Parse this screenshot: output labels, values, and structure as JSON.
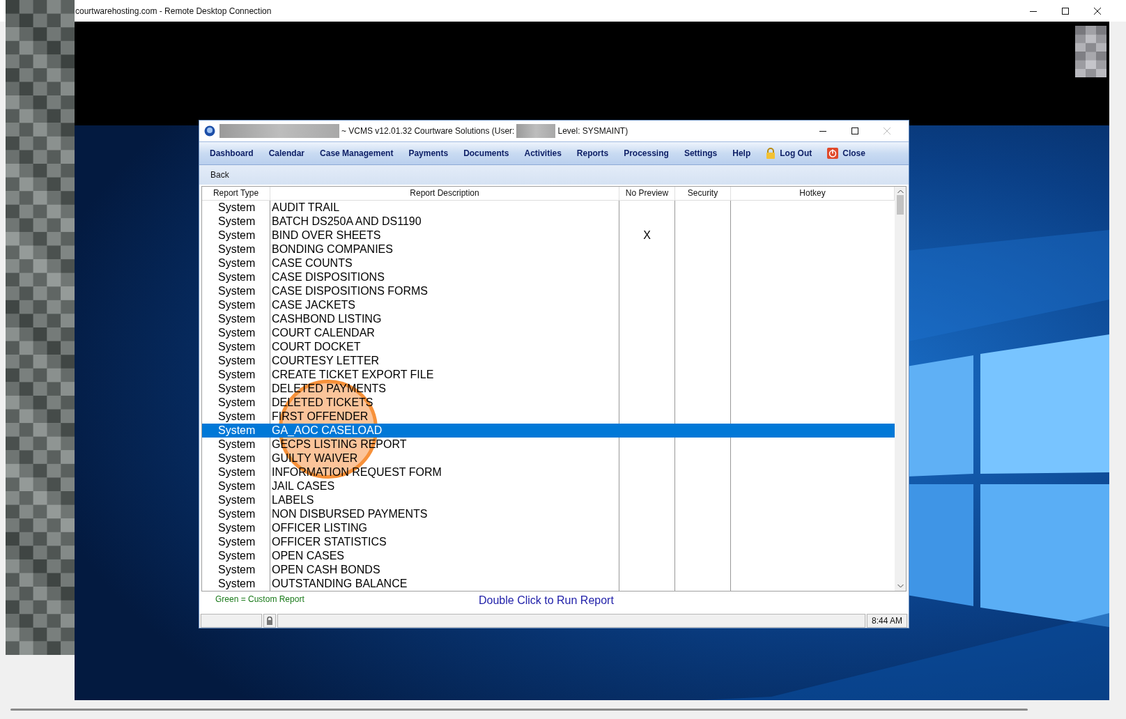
{
  "remote_window": {
    "title": "courtwarehosting.com - Remote Desktop Connection"
  },
  "app_window": {
    "title_prefix": "~ VCMS v12.01.32 Courtware Solutions (User:",
    "title_suffix": "Level: SYSMAINT)"
  },
  "menu": [
    {
      "label": "Dashboard",
      "kind": "text"
    },
    {
      "label": "Calendar",
      "kind": "text"
    },
    {
      "label": "Case Management",
      "kind": "text"
    },
    {
      "label": "Payments",
      "kind": "text"
    },
    {
      "label": "Documents",
      "kind": "text"
    },
    {
      "label": "Activities",
      "kind": "text"
    },
    {
      "label": "Reports",
      "kind": "text"
    },
    {
      "label": "Processing",
      "kind": "text"
    },
    {
      "label": "Settings",
      "kind": "text"
    },
    {
      "label": "Help",
      "kind": "text"
    },
    {
      "label": "Log Out",
      "kind": "lock"
    },
    {
      "label": "Close",
      "kind": "power"
    }
  ],
  "back_button": "Back",
  "table": {
    "columns": [
      "Report Type",
      "Report Description",
      "No Preview",
      "Security",
      "Hotkey"
    ],
    "rows": [
      {
        "type": "System",
        "description": "AUDIT TRAIL",
        "no_preview": "",
        "selected": false
      },
      {
        "type": "System",
        "description": "BATCH DS250A AND DS1190",
        "no_preview": "",
        "selected": false
      },
      {
        "type": "System",
        "description": "BIND OVER SHEETS",
        "no_preview": "X",
        "selected": false
      },
      {
        "type": "System",
        "description": "BONDING COMPANIES",
        "no_preview": "",
        "selected": false
      },
      {
        "type": "System",
        "description": "CASE COUNTS",
        "no_preview": "",
        "selected": false
      },
      {
        "type": "System",
        "description": "CASE DISPOSITIONS",
        "no_preview": "",
        "selected": false
      },
      {
        "type": "System",
        "description": "CASE DISPOSITIONS FORMS",
        "no_preview": "",
        "selected": false
      },
      {
        "type": "System",
        "description": "CASE JACKETS",
        "no_preview": "",
        "selected": false
      },
      {
        "type": "System",
        "description": "CASHBOND LISTING",
        "no_preview": "",
        "selected": false
      },
      {
        "type": "System",
        "description": "COURT CALENDAR",
        "no_preview": "",
        "selected": false
      },
      {
        "type": "System",
        "description": "COURT DOCKET",
        "no_preview": "",
        "selected": false
      },
      {
        "type": "System",
        "description": "COURTESY LETTER",
        "no_preview": "",
        "selected": false
      },
      {
        "type": "System",
        "description": "CREATE TICKET EXPORT FILE",
        "no_preview": "",
        "selected": false
      },
      {
        "type": "System",
        "description": "DELETED PAYMENTS",
        "no_preview": "",
        "selected": false
      },
      {
        "type": "System",
        "description": "DELETED TICKETS",
        "no_preview": "",
        "selected": false
      },
      {
        "type": "System",
        "description": "FIRST OFFENDER",
        "no_preview": "",
        "selected": false
      },
      {
        "type": "System",
        "description": "GA_AOC CASELOAD",
        "no_preview": "",
        "selected": true
      },
      {
        "type": "System",
        "description": "GECPS LISTING REPORT",
        "no_preview": "",
        "selected": false
      },
      {
        "type": "System",
        "description": "GUILTY WAIVER",
        "no_preview": "",
        "selected": false
      },
      {
        "type": "System",
        "description": "INFORMATION REQUEST FORM",
        "no_preview": "",
        "selected": false
      },
      {
        "type": "System",
        "description": "JAIL CASES",
        "no_preview": "",
        "selected": false
      },
      {
        "type": "System",
        "description": "LABELS",
        "no_preview": "",
        "selected": false
      },
      {
        "type": "System",
        "description": "NON DISBURSED PAYMENTS",
        "no_preview": "",
        "selected": false
      },
      {
        "type": "System",
        "description": "OFFICER LISTING",
        "no_preview": "",
        "selected": false
      },
      {
        "type": "System",
        "description": "OFFICER STATISTICS",
        "no_preview": "",
        "selected": false
      },
      {
        "type": "System",
        "description": "OPEN CASES",
        "no_preview": "",
        "selected": false
      },
      {
        "type": "System",
        "description": "OPEN CASH BONDS",
        "no_preview": "",
        "selected": false
      },
      {
        "type": "System",
        "description": "OUTSTANDING BALANCE",
        "no_preview": "",
        "selected": false
      }
    ]
  },
  "legend": "Green = Custom Report",
  "hint": "Double Click to Run Report",
  "status_bar": {
    "time": "8:44 AM"
  },
  "annotation": {
    "kind": "circle"
  }
}
